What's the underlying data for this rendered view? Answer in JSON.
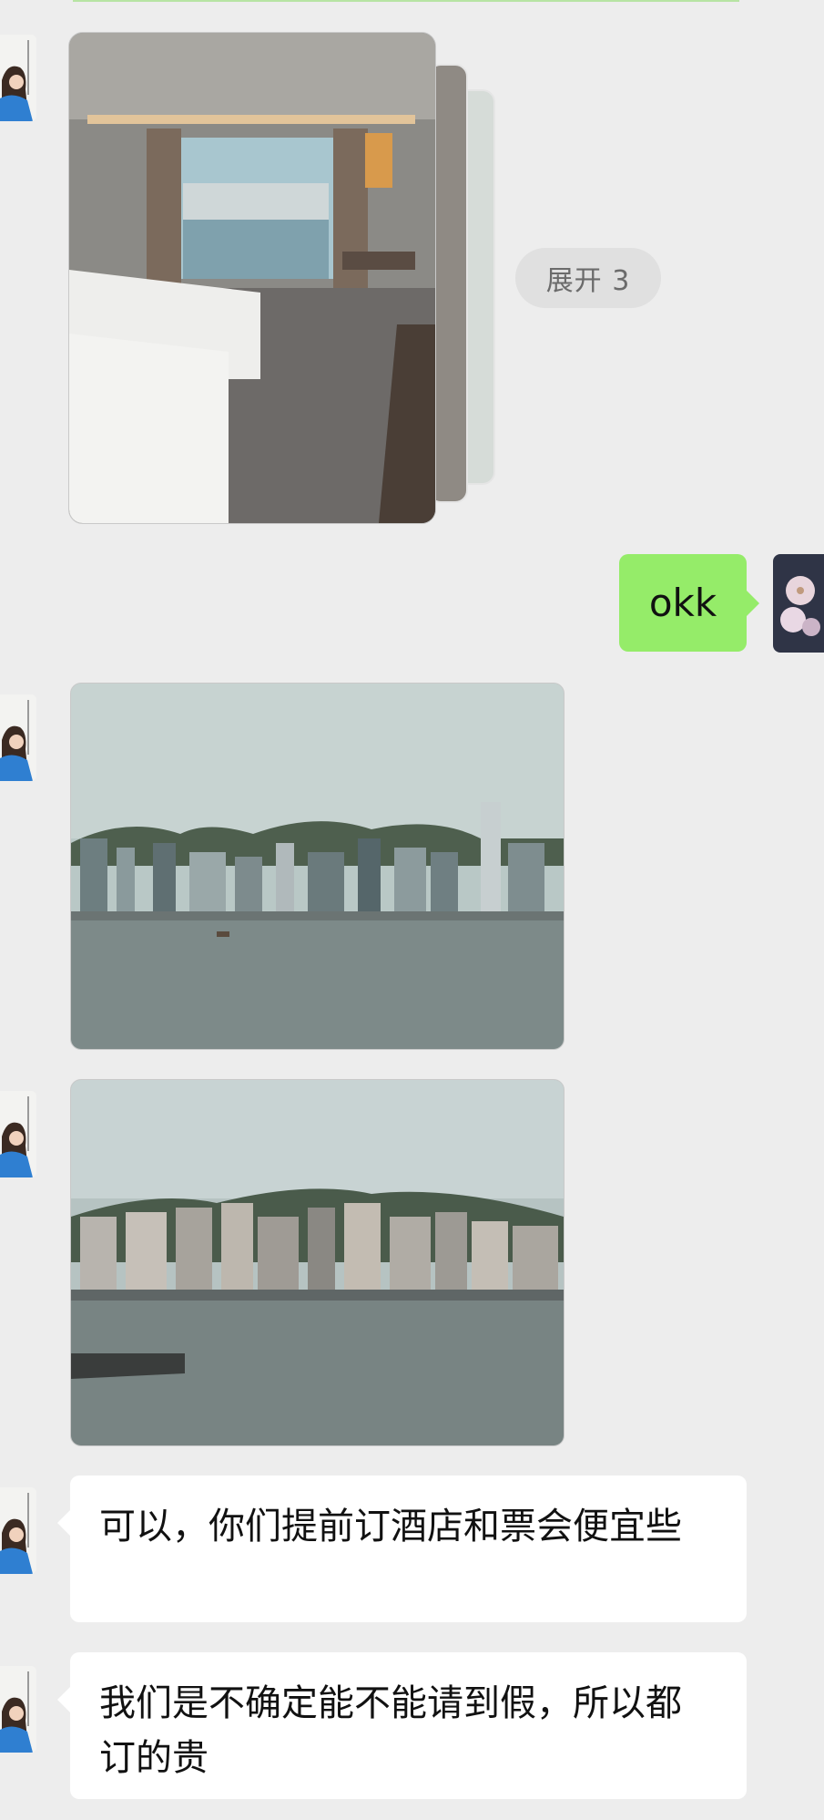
{
  "chat": {
    "expand_label": "展开 3",
    "sent_message": "okk",
    "received_messages": [
      "可以，你们提前订酒店和票会便宜些",
      "我们是不确定能不能请到假，所以都订的贵"
    ],
    "images": [
      {
        "icon": "hotel-room-photo"
      },
      {
        "icon": "harbour-skyline-photo"
      },
      {
        "icon": "harbour-skyline-photo-2"
      }
    ]
  },
  "colors": {
    "background": "#ededed",
    "sent_bubble": "#95ec69",
    "received_bubble": "#ffffff",
    "expand_pill": "#e0e0e0"
  }
}
